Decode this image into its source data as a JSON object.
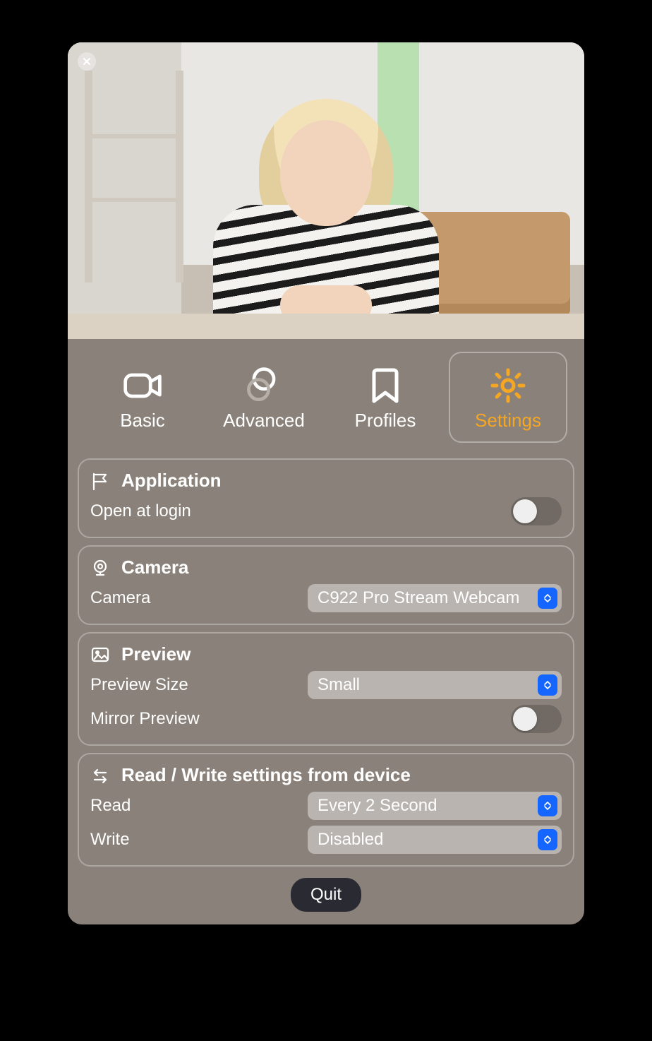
{
  "tabs": [
    {
      "label": "Basic",
      "icon": "camera-icon"
    },
    {
      "label": "Advanced",
      "icon": "overlap-icon"
    },
    {
      "label": "Profiles",
      "icon": "bookmark-icon"
    },
    {
      "label": "Settings",
      "icon": "gear-icon"
    }
  ],
  "active_tab": "Settings",
  "sections": {
    "application": {
      "title": "Application",
      "open_at_login_label": "Open at login",
      "open_at_login_value": false
    },
    "camera": {
      "title": "Camera",
      "camera_label": "Camera",
      "camera_value": "C922 Pro Stream Webcam"
    },
    "preview": {
      "title": "Preview",
      "size_label": "Preview Size",
      "size_value": "Small",
      "mirror_label": "Mirror Preview",
      "mirror_value": false
    },
    "rw": {
      "title": "Read / Write settings from device",
      "read_label": "Read",
      "read_value": "Every 2 Second",
      "write_label": "Write",
      "write_value": "Disabled"
    }
  },
  "quit_label": "Quit"
}
